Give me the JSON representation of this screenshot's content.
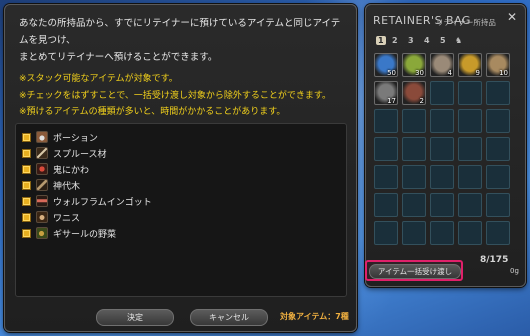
{
  "dialog": {
    "description_line1": "あなたの所持品から、すでにリテイナーに預けているアイテムと同じアイテムを見つけ、",
    "description_line2": "まとめてリテイナーへ預けることができます。",
    "note1": "※スタック可能なアイテムが対象です。",
    "note2": "※チェックをはずすことで、一括受け渡し対象から除外することができます。",
    "note3": "※預けるアイテムの種類が多いと、時間がかかることがあります。",
    "items": [
      {
        "label": "ポーション",
        "icon": "potion-icon",
        "color": "#8a5a3a"
      },
      {
        "label": "スプルース材",
        "icon": "lumber-icon",
        "color": "#6a5238"
      },
      {
        "label": "鬼にかわ",
        "icon": "glue-icon",
        "color": "#7a2e24"
      },
      {
        "label": "神代木",
        "icon": "log-icon",
        "color": "#5e4a36"
      },
      {
        "label": "ウォルフラムインゴット",
        "icon": "ingot-icon",
        "color": "#5a3a30"
      },
      {
        "label": "ワニス",
        "icon": "varnish-icon",
        "color": "#6a4a2e"
      },
      {
        "label": "ギサールの野菜",
        "icon": "vegetable-icon",
        "color": "#4e6a30"
      }
    ],
    "confirm_label": "決定",
    "cancel_label": "キャンセル",
    "target_label": "対象アイテム：7種"
  },
  "bag": {
    "title": "RETAINER'S BAG",
    "subtitle": "リテイナー所持品",
    "close_icon": "close-icon",
    "tabs": [
      "1",
      "2",
      "3",
      "4",
      "5",
      "♞"
    ],
    "active_tab": 0,
    "slots": [
      {
        "qty": "50",
        "color": "#3a78c8",
        "icon": "potion-icon"
      },
      {
        "qty": "30",
        "color": "#8aa83a",
        "icon": "vegetable-icon"
      },
      {
        "qty": "4",
        "color": "#9a8a78",
        "icon": "lumber-icon"
      },
      {
        "qty": "9",
        "color": "#c89a2a",
        "icon": "ingot-icon"
      },
      {
        "qty": "10",
        "color": "#a88a60",
        "icon": "log-icon"
      },
      {
        "qty": "17",
        "color": "#7a7a7a",
        "icon": "tool-icon"
      },
      {
        "qty": "2",
        "color": "#8a4a3a",
        "icon": "glue-icon"
      }
    ],
    "capacity": "8/175",
    "bulk_button_label": "アイテム一括受け渡し",
    "gil": "0g"
  }
}
